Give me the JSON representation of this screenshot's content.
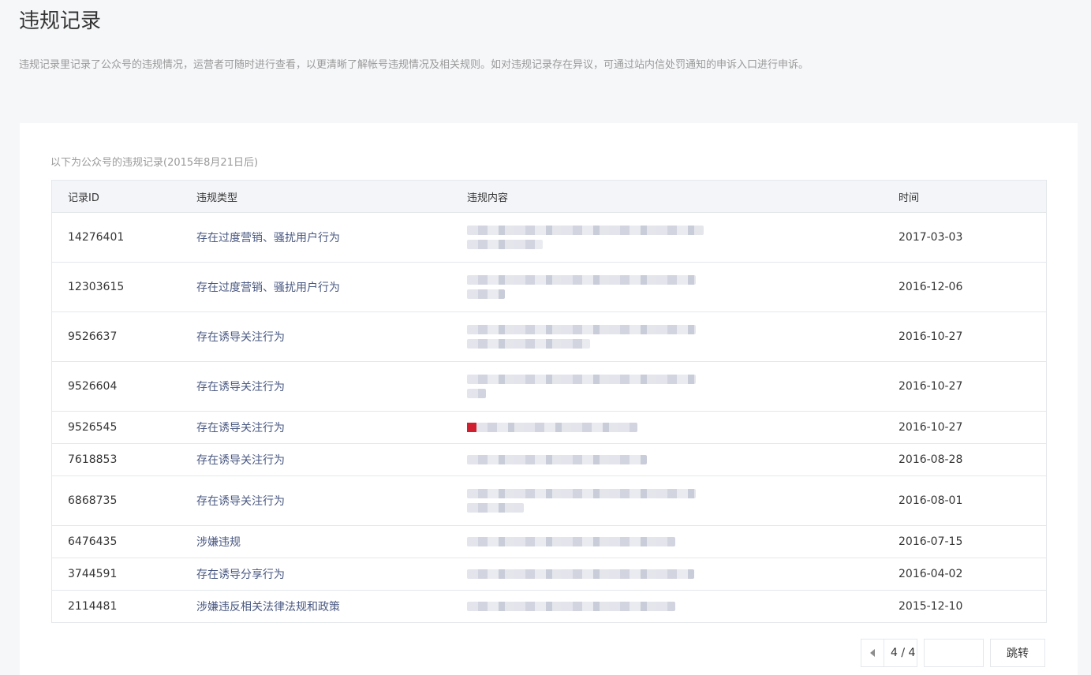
{
  "page": {
    "title": "违规记录",
    "description": "违规记录里记录了公众号的违规情况，运营者可随时进行查看，以更清晰了解帐号违规情况及相关规则。如对违规记录存在异议，可通过站内信处罚通知的申诉入口进行申诉。"
  },
  "card": {
    "caption": "以下为公众号的违规记录(2015年8月21日后)"
  },
  "table": {
    "headers": {
      "id": "记录ID",
      "type": "违规类型",
      "content": "违规内容",
      "time": "时间"
    },
    "rows": [
      {
        "id": "14276401",
        "type": "存在过度营销、骚扰用户行为",
        "time": "2017-03-03"
      },
      {
        "id": "12303615",
        "type": "存在过度营销、骚扰用户行为",
        "time": "2016-12-06"
      },
      {
        "id": "9526637",
        "type": "存在诱导关注行为",
        "time": "2016-10-27"
      },
      {
        "id": "9526604",
        "type": "存在诱导关注行为",
        "time": "2016-10-27"
      },
      {
        "id": "9526545",
        "type": "存在诱导关注行为",
        "time": "2016-10-27"
      },
      {
        "id": "7618853",
        "type": "存在诱导关注行为",
        "time": "2016-08-28"
      },
      {
        "id": "6868735",
        "type": "存在诱导关注行为",
        "time": "2016-08-01"
      },
      {
        "id": "6476435",
        "type": "涉嫌违规",
        "time": "2016-07-15"
      },
      {
        "id": "3744591",
        "type": "存在诱导分享行为",
        "time": "2016-04-02"
      },
      {
        "id": "2114481",
        "type": "涉嫌违反相关法律法规和政策",
        "time": "2015-12-10"
      }
    ]
  },
  "pager": {
    "indicator": "4 / 4",
    "jump_label": "跳转",
    "input_value": ""
  },
  "colors": {
    "type_link": "#4a5982",
    "background": "#f6f7f9",
    "header_bg": "#f4f5f9",
    "border": "#e4e8eb"
  }
}
